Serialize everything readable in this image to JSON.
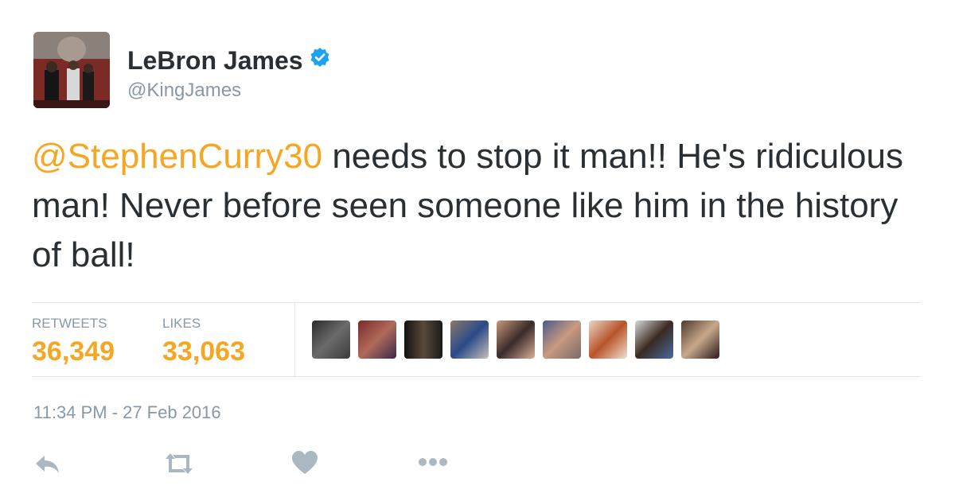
{
  "author": {
    "name": "LeBron James",
    "handle": "@KingJames",
    "verified": true
  },
  "tweet": {
    "mention": "@StephenCurry30",
    "text": " needs to stop it man!! He's ridiculous man! Never before seen someone like him in the history of ball!"
  },
  "stats": {
    "retweets_label": "RETWEETS",
    "retweets_value": "36,349",
    "likes_label": "LIKES",
    "likes_value": "33,063"
  },
  "likers_count": 9,
  "timestamp": "11:34 PM - 27 Feb 2016",
  "actions": [
    "reply-icon",
    "retweet-icon",
    "like-icon",
    "more-icon"
  ],
  "colors": {
    "accent": "#f5a623",
    "text": "#292f33",
    "muted": "#8899a6",
    "verified": "#1da1f2",
    "border": "#e1e8ed"
  }
}
